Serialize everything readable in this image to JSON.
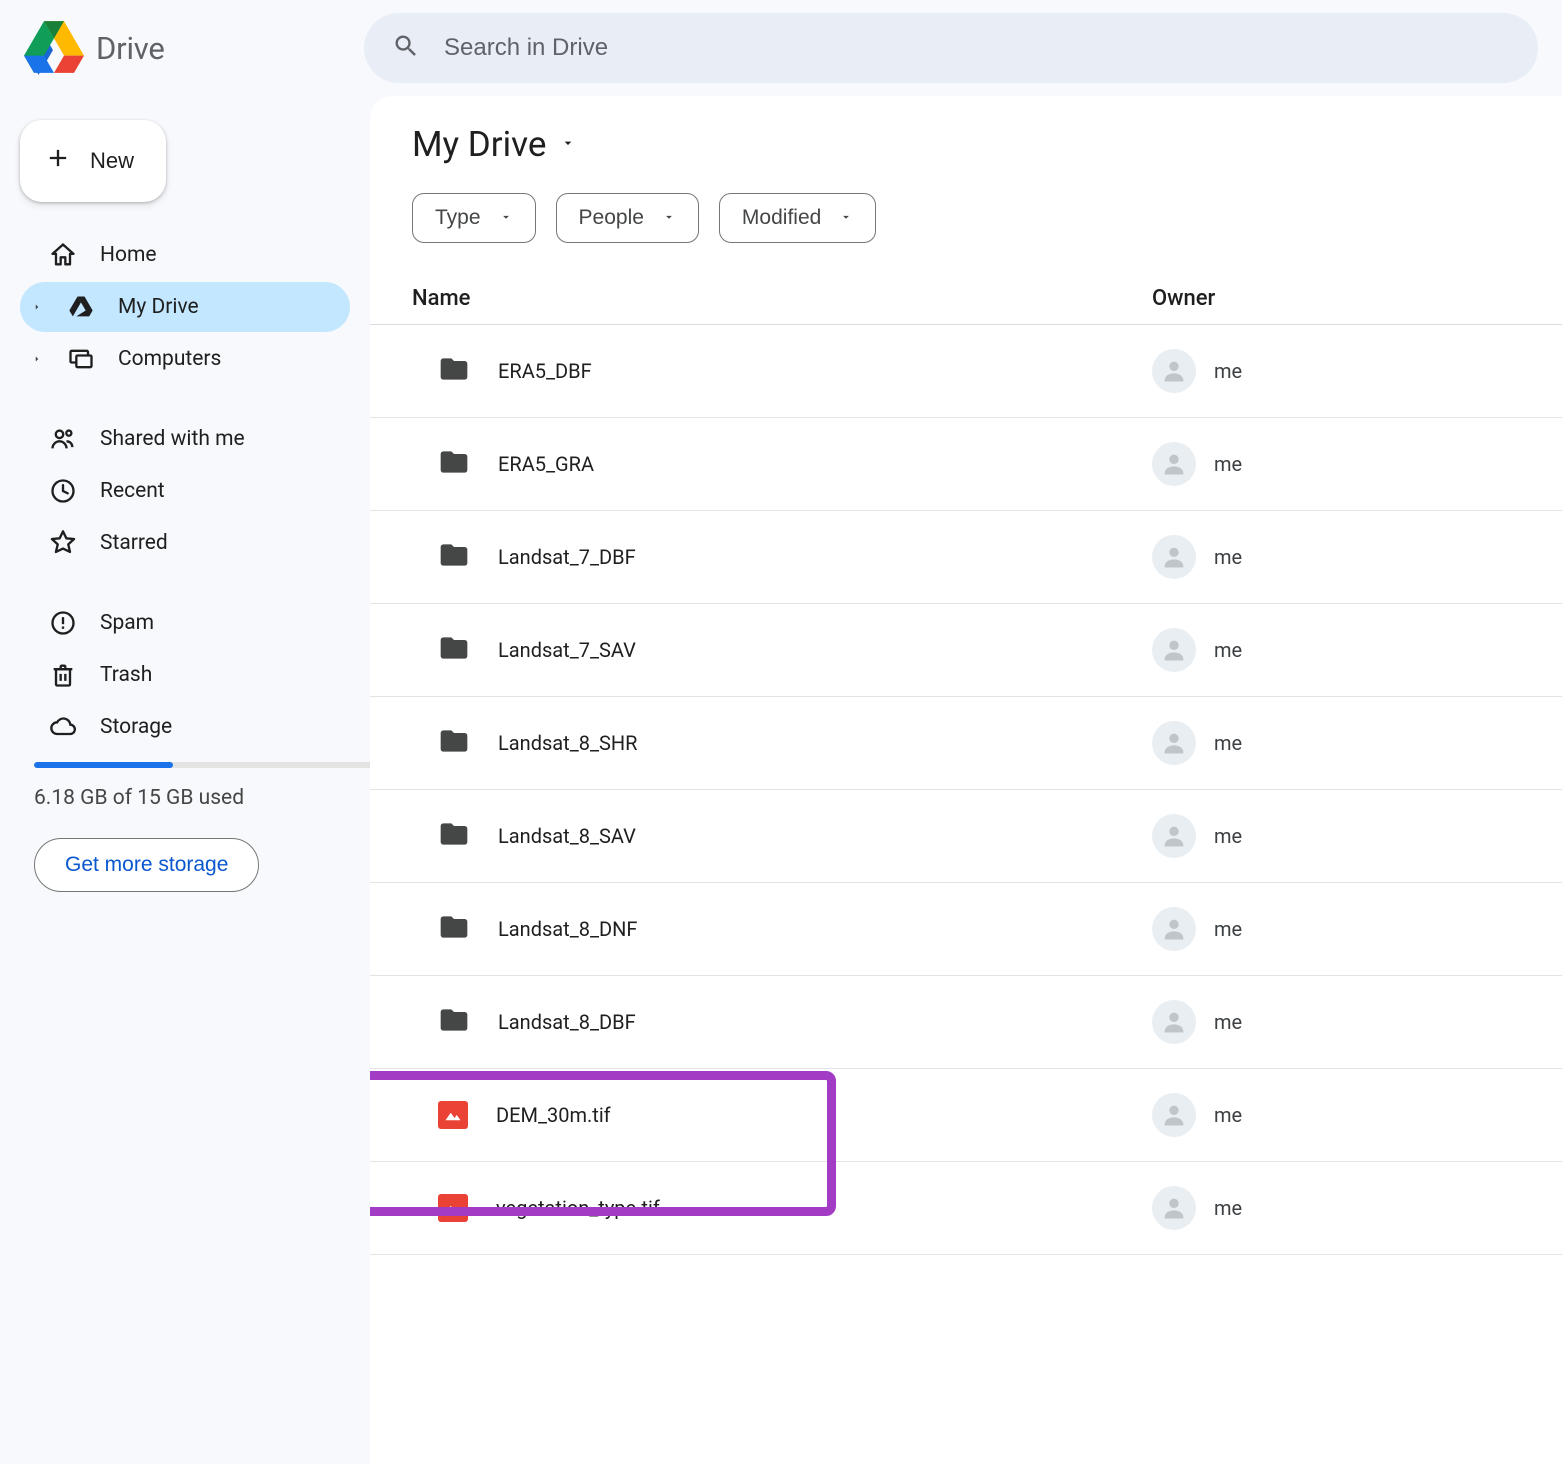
{
  "header": {
    "app_name": "Drive",
    "search_placeholder": "Search in Drive"
  },
  "sidebar": {
    "new_label": "New",
    "items": [
      {
        "icon": "home",
        "label": "Home",
        "has_chevron": false,
        "active": false
      },
      {
        "icon": "drive",
        "label": "My Drive",
        "has_chevron": true,
        "active": true
      },
      {
        "icon": "computers",
        "label": "Computers",
        "has_chevron": true,
        "active": false
      }
    ],
    "items2": [
      {
        "icon": "shared",
        "label": "Shared with me"
      },
      {
        "icon": "recent",
        "label": "Recent"
      },
      {
        "icon": "starred",
        "label": "Starred"
      }
    ],
    "items3": [
      {
        "icon": "spam",
        "label": "Spam"
      },
      {
        "icon": "trash",
        "label": "Trash"
      },
      {
        "icon": "storage",
        "label": "Storage"
      }
    ],
    "storage": {
      "percent": 41,
      "text": "6.18 GB of 15 GB used",
      "cta": "Get more storage"
    }
  },
  "main": {
    "title": "My Drive",
    "filters": [
      {
        "label": "Type"
      },
      {
        "label": "People"
      },
      {
        "label": "Modified"
      }
    ],
    "columns": {
      "name": "Name",
      "owner": "Owner"
    },
    "owner_me": "me",
    "rows": [
      {
        "type": "folder",
        "name": "ERA5_DBF",
        "owner": "me"
      },
      {
        "type": "folder",
        "name": "ERA5_GRA",
        "owner": "me"
      },
      {
        "type": "folder",
        "name": "Landsat_7_DBF",
        "owner": "me"
      },
      {
        "type": "folder",
        "name": "Landsat_7_SAV",
        "owner": "me"
      },
      {
        "type": "folder",
        "name": "Landsat_8_SHR",
        "owner": "me"
      },
      {
        "type": "folder",
        "name": "Landsat_8_SAV",
        "owner": "me"
      },
      {
        "type": "folder",
        "name": "Landsat_8_DNF",
        "owner": "me"
      },
      {
        "type": "folder",
        "name": "Landsat_8_DBF",
        "owner": "me"
      },
      {
        "type": "image",
        "name": "DEM_30m.tif",
        "owner": "me"
      },
      {
        "type": "image",
        "name": "vegetation_type.tif",
        "owner": "me"
      }
    ],
    "highlight_row_index": 8
  }
}
